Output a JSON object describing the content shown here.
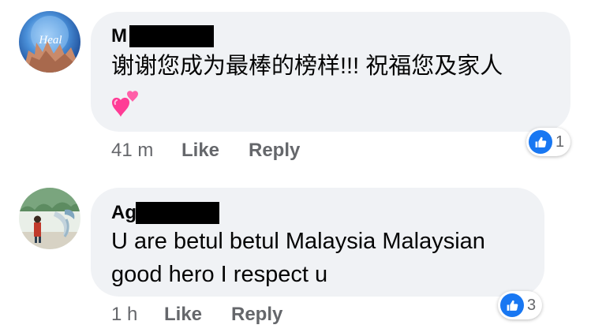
{
  "comments": [
    {
      "author": "M",
      "text": "谢谢您成为最棒的榜样!!! 祝福您及家人",
      "emoji_icon": "two-hearts-icon",
      "time": "41 m",
      "like_label": "Like",
      "reply_label": "Reply",
      "reaction_count": "1",
      "reaction_icon": "thumbs-up-icon"
    },
    {
      "author": "Ag",
      "text_line1": "U are betul betul Malaysia Malaysian",
      "text_line2": "good hero I respect u",
      "time": "1 h",
      "like_label": "Like",
      "reply_label": "Reply",
      "reaction_count": "3",
      "reaction_icon": "thumbs-up-icon"
    }
  ],
  "avatars": [
    {
      "label": "Heal"
    }
  ],
  "colors": {
    "bubble": "#f0f2f5",
    "meta_text": "#65676b",
    "like_blue": "#1877f2",
    "redaction": "#000000"
  }
}
